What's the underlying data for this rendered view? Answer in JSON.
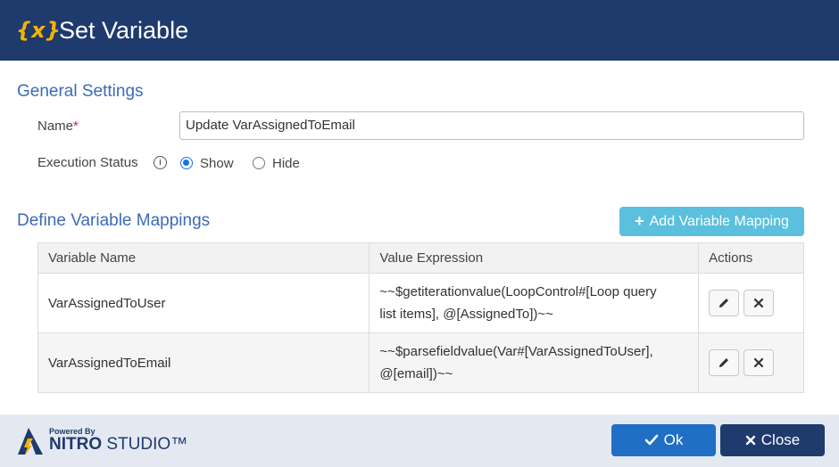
{
  "dialog": {
    "icon_text": "{x}",
    "title": "Set Variable"
  },
  "general": {
    "section_title": "General Settings",
    "name_label": "Name",
    "required_mark": "*",
    "name_value": "Update VarAssignedToEmail",
    "status_label": "Execution Status",
    "status_options": [
      {
        "label": "Show",
        "checked": true
      },
      {
        "label": "Hide",
        "checked": false
      }
    ]
  },
  "mappings": {
    "section_title": "Define Variable Mappings",
    "add_button_label": "Add Variable Mapping",
    "columns": [
      "Variable Name",
      "Value Expression",
      "Actions"
    ],
    "rows": [
      {
        "variable": "VarAssignedToUser",
        "expression_line1": "~~$getiterationvalue(LoopControl#[Loop query",
        "expression_line2": "list items], @[AssignedTo])~~"
      },
      {
        "variable": "VarAssignedToEmail",
        "expression_line1": "~~$parsefieldvalue(Var#[VarAssignedToUser],",
        "expression_line2": "@[email])~~"
      }
    ]
  },
  "footer": {
    "powered_by": "Powered By",
    "brand_bold": "NITRO",
    "brand_rest": " STUDIO™",
    "ok_label": "Ok",
    "close_label": "Close"
  },
  "colors": {
    "header": "#1f3a6d",
    "accent": "#3b6bb8",
    "add_button": "#5bc0de",
    "ok_button": "#1f6fc5",
    "close_button": "#1f3a6d"
  }
}
